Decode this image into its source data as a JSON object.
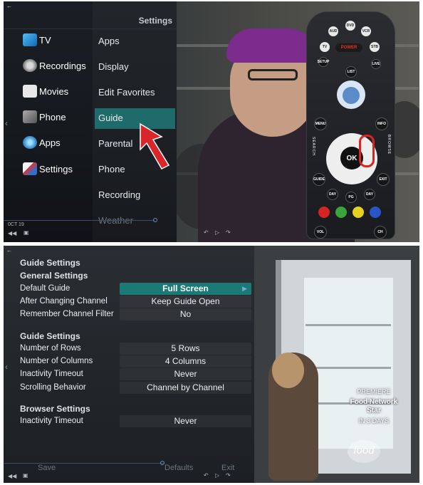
{
  "top_screen": {
    "title": "Settings",
    "main_menu": [
      {
        "label": "TV",
        "icon": "tv-icon"
      },
      {
        "label": "Recordings",
        "icon": "recordings-icon"
      },
      {
        "label": "Movies",
        "icon": "vod-movies-icon"
      },
      {
        "label": "Phone",
        "icon": "phone-icon"
      },
      {
        "label": "Apps",
        "icon": "apps-icon"
      },
      {
        "label": "Settings",
        "icon": "settings-icon"
      }
    ],
    "submenu": [
      "Apps",
      "Display",
      "Edit Favorites",
      "Guide",
      "Parental",
      "Phone",
      "Recording",
      "Weather"
    ],
    "selected_submenu": "Guide",
    "remote": {
      "buttons": [
        "AUD",
        "DVD",
        "VCR",
        "TV",
        "POWER",
        "STB",
        "SETUP",
        "LIVE",
        "LIST",
        "MENU",
        "INFO",
        "OK",
        "GUIDE",
        "EXIT",
        "DAY",
        "PG",
        "DAY",
        "VOL",
        "CH"
      ],
      "side_left": "SEARCH",
      "side_right": "BROWSE",
      "color_keys": [
        "#d42424",
        "#3aa33a",
        "#e5d220",
        "#2a55c9"
      ]
    },
    "status_left": "0CT 19"
  },
  "bottom_screen": {
    "sections": [
      {
        "header": "Guide Settings"
      },
      {
        "header": "General Settings"
      }
    ],
    "general": [
      {
        "label": "Default Guide",
        "value": "Full Screen",
        "selected": true
      },
      {
        "label": "After Changing Channel",
        "value": "Keep Guide Open"
      },
      {
        "label": "Remember Channel Filter",
        "value": "No"
      }
    ],
    "guide_header": "Guide Settings",
    "guide": [
      {
        "label": "Number of Rows",
        "value": "5 Rows"
      },
      {
        "label": "Number of Columns",
        "value": "4 Columns"
      },
      {
        "label": "Inactivity Timeout",
        "value": "Never"
      },
      {
        "label": "Scrolling Behavior",
        "value": "Channel by Channel"
      }
    ],
    "browser_header": "Browser Settings",
    "browser": [
      {
        "label": "Inactivity Timeout",
        "value": "Never"
      }
    ],
    "footer": {
      "save": "Save",
      "defaults": "Defaults",
      "exit": "Exit"
    },
    "promo": {
      "line1": "PREMIERE",
      "line2": "Food Network",
      "line3": "Star",
      "line4": "IN 3 DAYS"
    },
    "channel_logo": "food"
  },
  "colors": {
    "highlight": "#1f6b6b",
    "selected_value": "#1b7a76",
    "arrow": "#d9262a"
  }
}
